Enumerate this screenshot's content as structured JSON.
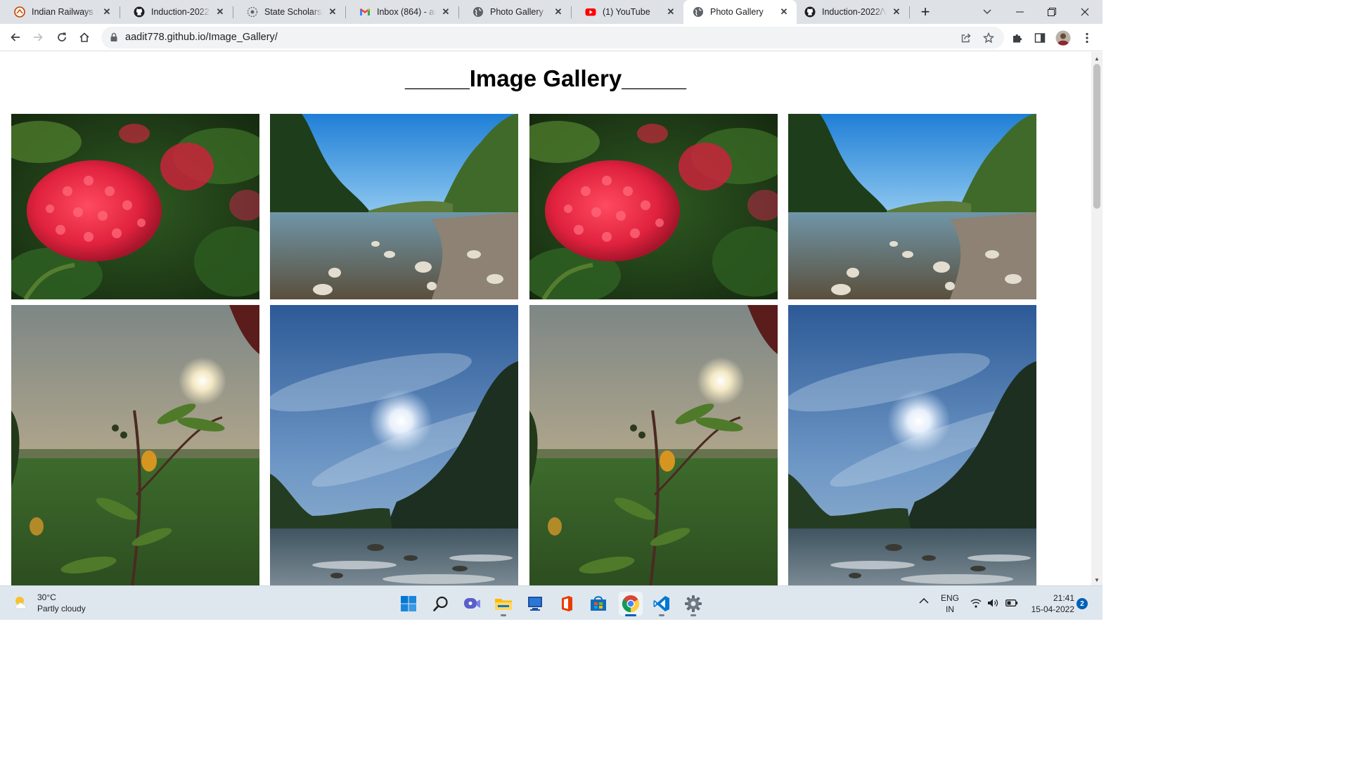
{
  "browser": {
    "tabs": [
      {
        "title": "Indian Railways M",
        "icon": "railways-logo-icon",
        "active": false
      },
      {
        "title": "Induction-2022/s",
        "icon": "github-icon",
        "active": false
      },
      {
        "title": "State Scholarship",
        "icon": "scholarship-logo-icon",
        "active": false
      },
      {
        "title": "Inbox (864) - aad",
        "icon": "gmail-icon",
        "active": false
      },
      {
        "title": "Photo Gallery",
        "icon": "globe-icon",
        "active": false
      },
      {
        "title": "(1) YouTube",
        "icon": "youtube-icon",
        "active": false
      },
      {
        "title": "Photo Gallery",
        "icon": "globe-icon",
        "active": true
      },
      {
        "title": "Induction-2022/V",
        "icon": "github-icon",
        "active": false
      }
    ],
    "close_glyph": "✕",
    "new_tab_glyph": "+",
    "address": {
      "url": "aadit778.github.io/Image_Gallery/"
    }
  },
  "page": {
    "title": "_____Image Gallery_____",
    "photos": [
      {
        "subject": "red ixora flowers"
      },
      {
        "subject": "rocky river under blue sky"
      },
      {
        "subject": "red ixora flowers"
      },
      {
        "subject": "rocky river under blue sky"
      },
      {
        "subject": "plant against hazy sun over field"
      },
      {
        "subject": "sun in blue sky above forest river"
      },
      {
        "subject": "plant against hazy sun over field"
      },
      {
        "subject": "sun in blue sky above forest river"
      }
    ]
  },
  "taskbar": {
    "weather": {
      "temperature": "30°C",
      "condition": "Partly cloudy"
    },
    "apps": [
      {
        "icon": "windows-start-icon",
        "active": false,
        "running": false
      },
      {
        "icon": "search-icon",
        "active": false,
        "running": false
      },
      {
        "icon": "teams-chat-icon",
        "active": false,
        "running": false
      },
      {
        "icon": "file-explorer-icon",
        "active": false,
        "running": true
      },
      {
        "icon": "monitor-app-icon",
        "active": false,
        "running": false
      },
      {
        "icon": "office-icon",
        "active": false,
        "running": false
      },
      {
        "icon": "microsoft-store-icon",
        "active": false,
        "running": false
      },
      {
        "icon": "chrome-icon",
        "active": true,
        "running": true
      },
      {
        "icon": "vscode-icon",
        "active": false,
        "running": true
      },
      {
        "icon": "settings-icon",
        "active": false,
        "running": true
      }
    ],
    "language": {
      "line1": "ENG",
      "line2": "IN"
    },
    "time": "21:41",
    "date": "15-04-2022",
    "notification_count": "2"
  },
  "colors": {
    "tabstrip_bg": "#dee1e6",
    "accent": "#005fb8",
    "youtube_red": "#ff0000"
  }
}
